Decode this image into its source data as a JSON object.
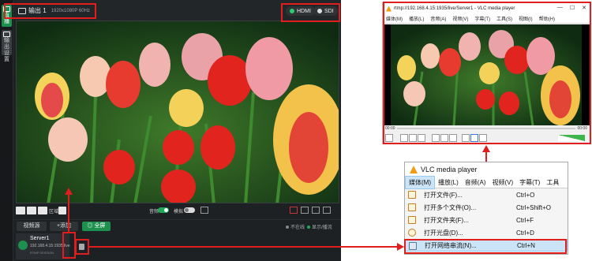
{
  "encoder": {
    "sidebar": [
      {
        "label": "直播"
      },
      {
        "label": "输出设置"
      }
    ],
    "output": {
      "title": "输出 1",
      "resolution": "1920x1080P 60Hz"
    },
    "outputs": {
      "hdmi": "HDMI",
      "sdi": "SDI"
    },
    "controls": {
      "mode_label": "区域",
      "audio_label": "音频",
      "mode2_label": "模拟"
    },
    "sources": {
      "video_label": "视频源",
      "add_label": "+添加",
      "record_label": "◎ 全屏"
    },
    "status": {
      "offline": "不在线",
      "display": "显示/播流"
    },
    "server": {
      "name": "Server1",
      "url": "192.168.4.15:1935/live",
      "session": "RTMP SESSION"
    }
  },
  "vlc": {
    "title": "rtmp://192.168.4.15:1935/live/Server1 - VLC media player",
    "menu": [
      "媒体(M)",
      "播放(L)",
      "音频(A)",
      "视频(V)",
      "字幕(T)",
      "工具(S)",
      "视图(I)",
      "帮助(H)"
    ],
    "time_left": "00:00",
    "time_right": "00:00"
  },
  "vlc_menu": {
    "title": "VLC media player",
    "bar": [
      "媒体(M)",
      "播放(L)",
      "音频(A)",
      "视频(V)",
      "字幕(T)",
      "工具"
    ],
    "items": [
      {
        "label": "打开文件(F)...",
        "shortcut": "Ctrl+O"
      },
      {
        "label": "打开多个文件(O)...",
        "shortcut": "Ctrl+Shift+O"
      },
      {
        "label": "打开文件夹(F)...",
        "shortcut": "Ctrl+F"
      },
      {
        "label": "打开光盘(D)...",
        "shortcut": "Ctrl+D"
      },
      {
        "label": "打开网络串流(N)...",
        "shortcut": "Ctrl+N"
      }
    ]
  },
  "colors": {
    "highlight": "#e01e1e",
    "accent_green": "#1d8f4e",
    "menu_hover": "#cce4f7"
  }
}
